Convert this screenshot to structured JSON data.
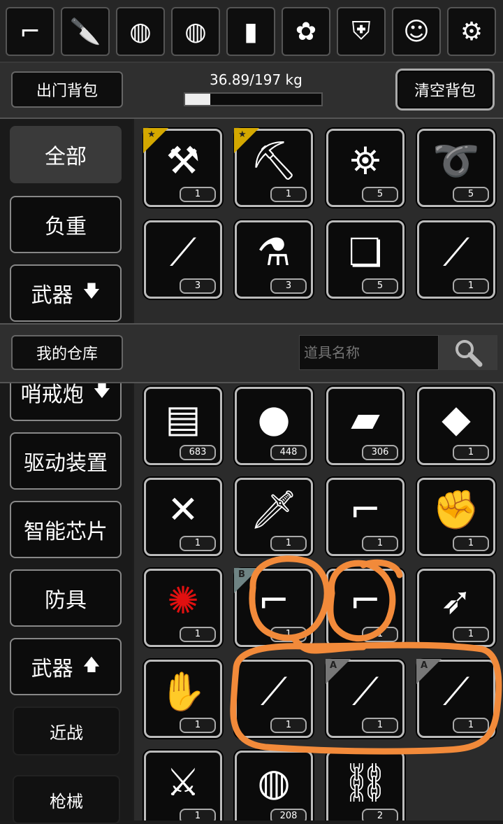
{
  "quick_slots": [
    {
      "icon": "sniper-rifle-icon",
      "glyph": "⌐"
    },
    {
      "icon": "knife-icon",
      "glyph": "🔪"
    },
    {
      "icon": "net-trap-icon",
      "glyph": "◍"
    },
    {
      "icon": "net-trap-icon",
      "glyph": "◍"
    },
    {
      "icon": "armor-plate-icon",
      "glyph": "▮"
    },
    {
      "icon": "plant-creature-icon",
      "glyph": "✿"
    },
    {
      "icon": "rabbit-costume-icon",
      "glyph": "⛨"
    },
    {
      "icon": "rabbit-head-icon",
      "glyph": "☺"
    },
    {
      "icon": "robot-kit-icon",
      "glyph": "⚙"
    }
  ],
  "pack": {
    "title": "出门背包",
    "weight": "36.89/197 kg",
    "weight_fraction": 0.187,
    "clear_button": "清空背包"
  },
  "sidebar_top": [
    {
      "label": "全部",
      "selected": true,
      "arrow": ""
    },
    {
      "label": "负重",
      "selected": false,
      "arrow": ""
    },
    {
      "label": "武器",
      "selected": false,
      "arrow": "🡇"
    }
  ],
  "pack_items": [
    {
      "icon": "multitool-icon",
      "glyph": "⚒",
      "qty": "1",
      "badge": "star"
    },
    {
      "icon": "shovel-icon",
      "glyph": "⛏",
      "qty": "1",
      "badge": "star"
    },
    {
      "icon": "lanterns-icon",
      "glyph": "⛯",
      "qty": "5",
      "badge": ""
    },
    {
      "icon": "rope-icon",
      "glyph": "➰",
      "qty": "5",
      "badge": ""
    },
    {
      "icon": "lockpicks-icon",
      "glyph": "⟋",
      "qty": "3",
      "badge": ""
    },
    {
      "icon": "tool-bucket-icon",
      "glyph": "⚗",
      "qty": "3",
      "badge": ""
    },
    {
      "icon": "bandage-wrap-icon",
      "glyph": "❏",
      "qty": "5",
      "badge": ""
    },
    {
      "icon": "baton-icon",
      "glyph": "⟋",
      "qty": "1",
      "badge": ""
    }
  ],
  "warehouse": {
    "title": "我的仓库",
    "search_placeholder": "道具名称"
  },
  "sidebar_bottom": [
    {
      "label": "哨戒炮",
      "arrow": "🡇"
    },
    {
      "label": "驱动装置",
      "arrow": ""
    },
    {
      "label": "智能芯片",
      "arrow": ""
    },
    {
      "label": "防具",
      "arrow": ""
    },
    {
      "label": "武器",
      "arrow": "🡅"
    }
  ],
  "sub_categories": [
    "近战",
    "枪械"
  ],
  "warehouse_items": [
    {
      "icon": "ammo-box-icon",
      "glyph": "▤",
      "qty": "683",
      "badge": ""
    },
    {
      "icon": "grenade-icon",
      "glyph": "●",
      "qty": "448",
      "badge": ""
    },
    {
      "icon": "battery-pack-icon",
      "glyph": "▰",
      "qty": "306",
      "badge": ""
    },
    {
      "icon": "module-chip-icon",
      "glyph": "◆",
      "qty": "1",
      "badge": ""
    },
    {
      "icon": "crossbow-icon",
      "glyph": "✕",
      "qty": "1",
      "badge": ""
    },
    {
      "icon": "combat-knife-icon",
      "glyph": "🗡",
      "qty": "1",
      "badge": ""
    },
    {
      "icon": "grenade-launcher-icon",
      "glyph": "⌐",
      "qty": "1",
      "badge": ""
    },
    {
      "icon": "power-gauntlet-icon",
      "glyph": "✊",
      "qty": "1",
      "badge": ""
    },
    {
      "icon": "red-flower-icon",
      "glyph": "✺",
      "qty": "1",
      "badge": "",
      "color": "#e01010"
    },
    {
      "icon": "assault-rifle-icon",
      "glyph": "⌐",
      "qty": "1",
      "badge": "B"
    },
    {
      "icon": "assault-rifle-icon",
      "glyph": "⌐",
      "qty": "1",
      "badge": ""
    },
    {
      "icon": "compound-bow-icon",
      "glyph": "➶",
      "qty": "1",
      "badge": ""
    },
    {
      "icon": "hand-crossbow-icon",
      "glyph": "✋",
      "qty": "1",
      "badge": ""
    },
    {
      "icon": "katana-icon",
      "glyph": "⟋",
      "qty": "1",
      "badge": ""
    },
    {
      "icon": "katana-icon",
      "glyph": "⟋",
      "qty": "1",
      "badge": "A"
    },
    {
      "icon": "katana-icon",
      "glyph": "⟋",
      "qty": "1",
      "badge": "A"
    },
    {
      "icon": "axe-blade-icon",
      "glyph": "⚔",
      "qty": "1",
      "badge": ""
    },
    {
      "icon": "net-trap-icon",
      "glyph": "◍",
      "qty": "208",
      "badge": ""
    },
    {
      "icon": "chain-whip-icon",
      "glyph": "⛓",
      "qty": "2",
      "badge": ""
    }
  ],
  "colors": {
    "annotation": "#f28a3a",
    "star_badge": "#d4a800"
  }
}
